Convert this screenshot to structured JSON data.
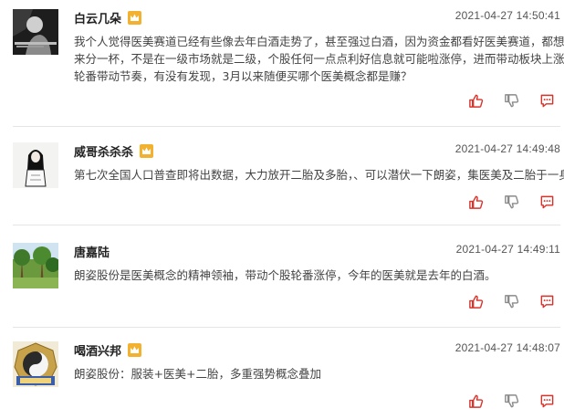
{
  "posts": [
    {
      "username": "白云几朵",
      "vip_icon": "crown-badge-icon",
      "time": "2021-04-27 14:50:41",
      "lines": [
        "我个人觉得医美赛道已经有些像去年白酒走势了，甚至强过白酒，因为资金都看好医美赛道，都想进",
        "来分一杯，不是在一级市场就是二级，个股任何一点点利好信息就可能啦涨停，进而带动板块上涨，",
        "轮番带动节奏，有没有发现，3月以来随便买哪个医美概念都是赚？"
      ]
    },
    {
      "username": "威哥杀杀杀",
      "vip_icon": "crown-badge-icon",
      "time": "2021-04-27 14:49:48",
      "lines": [
        "第七次全国人口普查即将出数据，大力放开二胎及多胎，、可以潜伏一下朗姿，集医美及二胎于一身"
      ]
    },
    {
      "username": "唐嘉陆",
      "time": "2021-04-27 14:49:11",
      "lines": [
        "朗姿股份是医美概念的精神领袖，带动个股轮番涨停，今年的医美就是去年的白酒。"
      ]
    },
    {
      "username": "喝酒兴邦",
      "vip_icon": "crown-badge-icon",
      "time": "2021-04-27 14:48:07",
      "lines": [
        "朗姿股份：服装+医美+二胎，多重强势概念叠加"
      ]
    }
  ],
  "action_icons": [
    "thumbs-up-icon",
    "thumbs-down-icon",
    "comment-icon"
  ],
  "colors": {
    "accent_red": "#d9322a",
    "action_gray": "#8a8a8a",
    "vip_gold": "#f2b230",
    "divider": "#e5e5e5"
  }
}
